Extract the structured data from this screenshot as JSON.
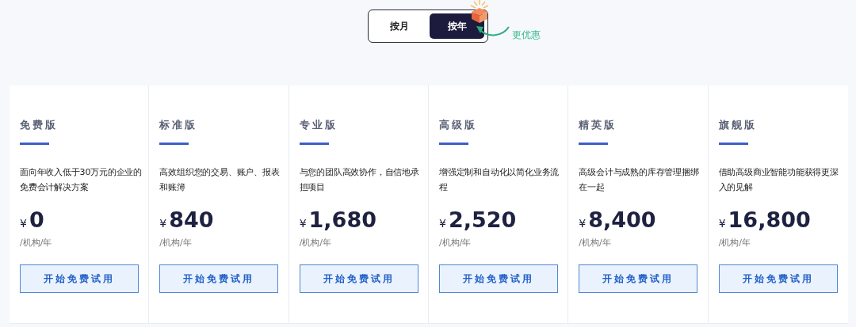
{
  "billing_toggle": {
    "options": [
      {
        "label": "按月",
        "selected": false
      },
      {
        "label": "按年",
        "selected": true
      }
    ],
    "promo": "更优惠"
  },
  "plans": [
    {
      "name": "免费版",
      "description": "面向年收入低于30万元的企业的免费会计解决方案",
      "currency": "¥",
      "price": "0",
      "unit": "/机构/年",
      "button": "开始免费试用"
    },
    {
      "name": "标准版",
      "description": "高效组织您的交易、账户、报表和账簿",
      "currency": "¥",
      "price": "840",
      "unit": "/机构/年",
      "button": "开始免费试用"
    },
    {
      "name": "专业版",
      "description": "与您的团队高效协作，自信地承担项目",
      "currency": "¥",
      "price": "1,680",
      "unit": "/机构/年",
      "button": "开始免费试用"
    },
    {
      "name": "高级版",
      "description": "增强定制和自动化以简化业务流程",
      "currency": "¥",
      "price": "2,520",
      "unit": "/机构/年",
      "button": "开始免费试用"
    },
    {
      "name": "精英版",
      "description": "高级会计与成熟的库存管理捆绑在一起",
      "currency": "¥",
      "price": "8,400",
      "unit": "/机构/年",
      "button": "开始免费试用"
    },
    {
      "name": "旗舰版",
      "description": "借助高级商业智能功能获得更深入的见解",
      "currency": "¥",
      "price": "16,800",
      "unit": "/机构/年",
      "button": "开始免费试用"
    }
  ]
}
